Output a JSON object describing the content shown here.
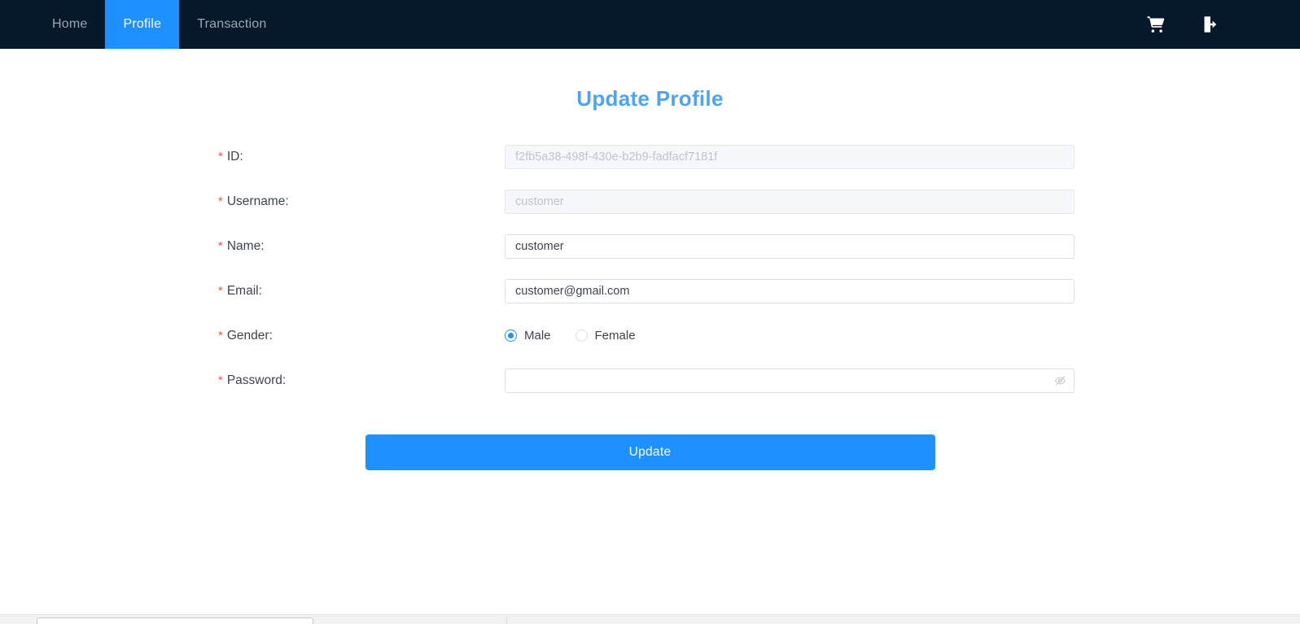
{
  "navbar": {
    "items": [
      {
        "label": "Home",
        "active": false
      },
      {
        "label": "Profile",
        "active": true
      },
      {
        "label": "Transaction",
        "active": false
      }
    ],
    "icons": [
      {
        "name": "shopping-cart-icon"
      },
      {
        "name": "logout-icon"
      }
    ],
    "background_color": "#06192c",
    "active_color": "#1e90ff"
  },
  "page": {
    "title": "Update Profile",
    "title_color": "#4da3f5",
    "required_mark": "*"
  },
  "form": {
    "fields": [
      {
        "key": "id",
        "label": "ID:",
        "value": "f2fb5a38-498f-430e-b2b9-fadfacf7181f",
        "disabled": true
      },
      {
        "key": "username",
        "label": "Username:",
        "value": "customer",
        "disabled": true
      },
      {
        "key": "name",
        "label": "Name:",
        "value": "customer",
        "disabled": false
      },
      {
        "key": "email",
        "label": "Email:",
        "value": "customer@gmail.com",
        "disabled": false
      }
    ],
    "gender": {
      "label": "Gender:",
      "options": [
        {
          "label": "Male",
          "selected": true
        },
        {
          "label": "Female",
          "selected": false
        }
      ]
    },
    "password": {
      "label": "Password:",
      "value": "",
      "placeholder": "",
      "toggle_icon": "eye-slash-icon"
    },
    "submit_label": "Update",
    "submit_color": "#1e90ff"
  }
}
